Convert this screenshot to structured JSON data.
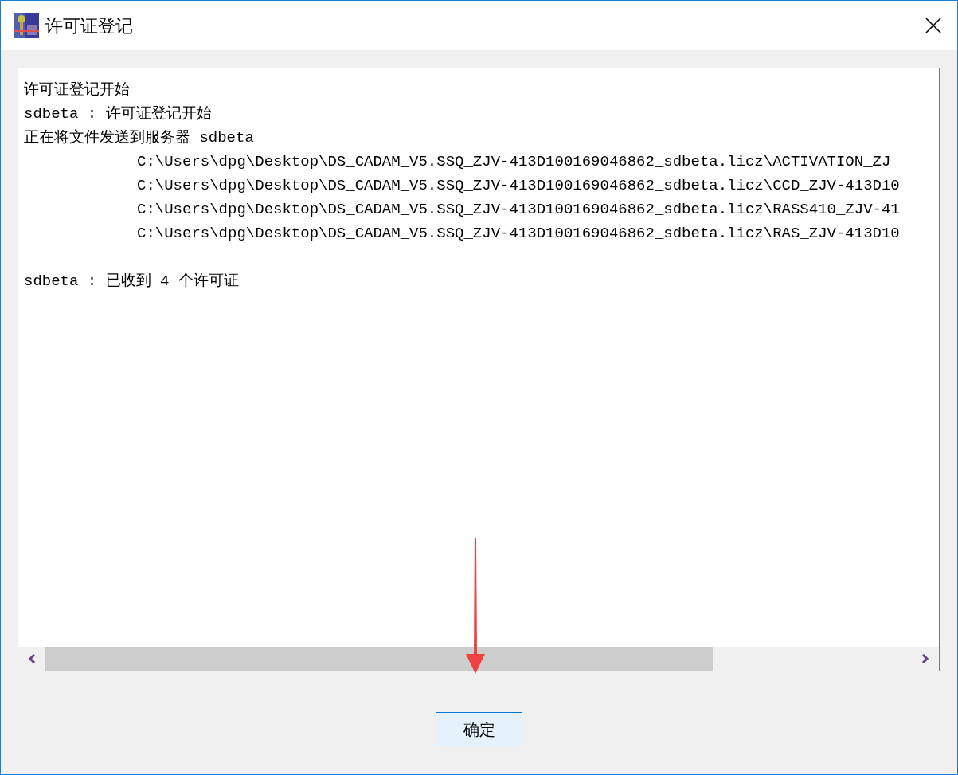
{
  "window": {
    "title": "许可证登记"
  },
  "log": [
    {
      "kind": "message",
      "text": "许可证登记开始"
    },
    {
      "kind": "message",
      "text": "sdbeta : 许可证登记开始"
    },
    {
      "kind": "message",
      "text": "正在将文件发送到服务器 sdbeta"
    },
    {
      "kind": "path",
      "text": "C:\\Users\\dpg\\Desktop\\DS_CADAM_V5.SSQ_ZJV-413D100169046862_sdbeta.licz\\ACTIVATION_ZJ"
    },
    {
      "kind": "path",
      "text": "C:\\Users\\dpg\\Desktop\\DS_CADAM_V5.SSQ_ZJV-413D100169046862_sdbeta.licz\\CCD_ZJV-413D10"
    },
    {
      "kind": "path",
      "text": "C:\\Users\\dpg\\Desktop\\DS_CADAM_V5.SSQ_ZJV-413D100169046862_sdbeta.licz\\RASS410_ZJV-41"
    },
    {
      "kind": "path",
      "text": "C:\\Users\\dpg\\Desktop\\DS_CADAM_V5.SSQ_ZJV-413D100169046862_sdbeta.licz\\RAS_ZJV-413D10"
    },
    {
      "kind": "summary",
      "text": "sdbeta : 已收到 4 个许可证"
    }
  ],
  "buttons": [
    {
      "label": "确定"
    }
  ]
}
